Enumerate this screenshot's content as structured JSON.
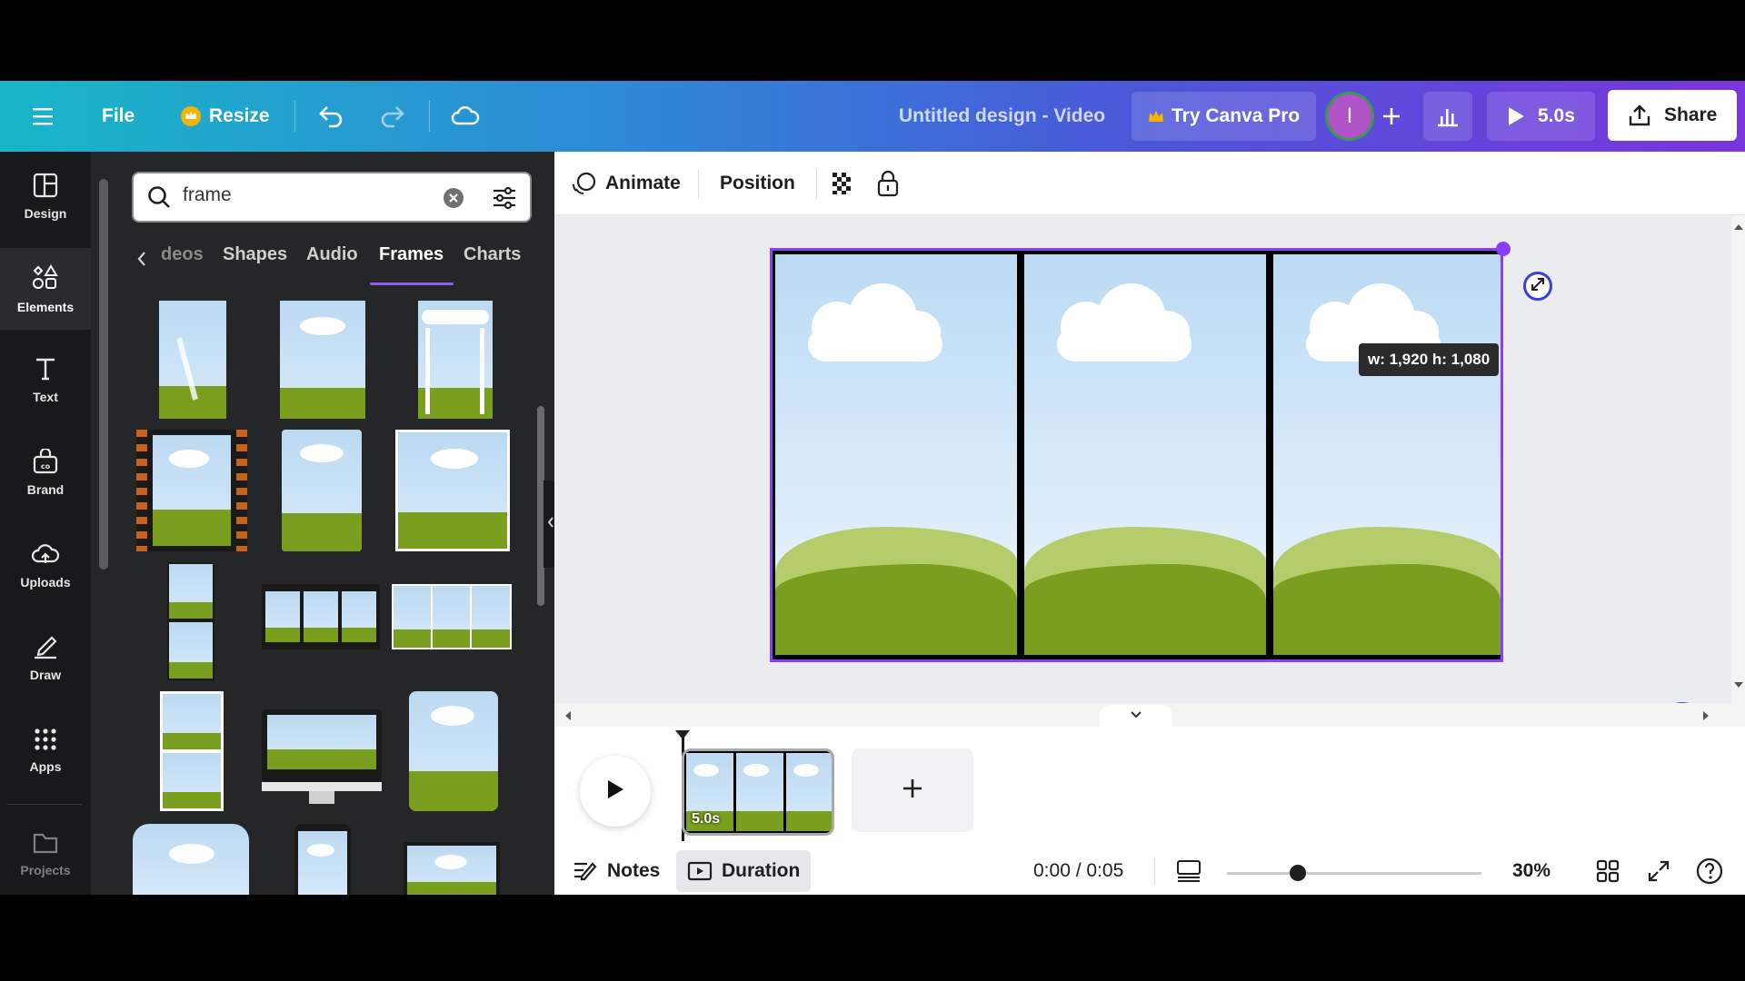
{
  "topbar": {
    "file_label": "File",
    "resize_label": "Resize",
    "title": "Untitled design - Video",
    "try_pro_label": "Try Canva Pro",
    "avatar_letter": "I",
    "duration_label": "5.0s",
    "share_label": "Share"
  },
  "rail": {
    "items": [
      {
        "label": "Design",
        "icon": "layout-icon"
      },
      {
        "label": "Elements",
        "icon": "shapes-icon"
      },
      {
        "label": "Text",
        "icon": "text-icon"
      },
      {
        "label": "Brand",
        "icon": "brand-icon"
      },
      {
        "label": "Uploads",
        "icon": "cloud-upload-icon"
      },
      {
        "label": "Draw",
        "icon": "draw-icon"
      },
      {
        "label": "Apps",
        "icon": "apps-grid-icon"
      },
      {
        "label": "Projects",
        "icon": "folder-icon"
      }
    ]
  },
  "panel": {
    "search_value": "frame",
    "tabs": [
      "deos",
      "Shapes",
      "Audio",
      "Frames",
      "Charts"
    ],
    "active_tab": "Frames"
  },
  "toolbar": {
    "animate_label": "Animate",
    "position_label": "Position"
  },
  "canvas": {
    "size_tooltip": "w: 1,920 h: 1,080"
  },
  "timeline": {
    "clip_duration": "5.0s",
    "notes_label": "Notes",
    "duration_label": "Duration",
    "time_display": "0:00 / 0:05",
    "zoom_level": "30%",
    "zoom_fraction": 0.28
  },
  "colors": {
    "accent": "#8b3dff",
    "grass": "#7a9e1e",
    "sky": "#bcd9f2"
  }
}
